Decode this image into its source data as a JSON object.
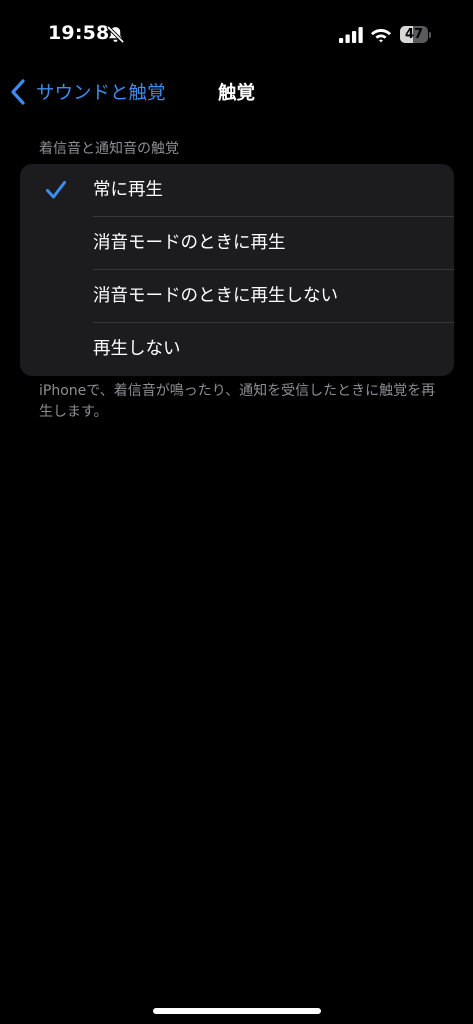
{
  "status_bar": {
    "time": "19:58",
    "battery_level": 47,
    "battery_text": "47",
    "icons": [
      "bell-slash-icon",
      "cellular-signal-icon",
      "wifi-icon",
      "battery-icon"
    ]
  },
  "nav": {
    "back_label": "サウンドと触覚",
    "back_icon": "chevron-left-icon",
    "title": "触覚"
  },
  "section": {
    "header": "着信音と通知音の触覚",
    "options": [
      {
        "label": "常に再生",
        "selected": true
      },
      {
        "label": "消音モードのときに再生",
        "selected": false
      },
      {
        "label": "消音モードのときに再生しない",
        "selected": false
      },
      {
        "label": "再生しない",
        "selected": false
      }
    ],
    "footer": "iPhoneで、着信音が鳴ったり、通知を受信したときに触覚を再生します。"
  },
  "colors": {
    "background": "#000000",
    "group_background": "#1c1c1e",
    "accent": "#3d8cf0",
    "secondary_text": "#8d8d93",
    "separator": "#38383a"
  }
}
